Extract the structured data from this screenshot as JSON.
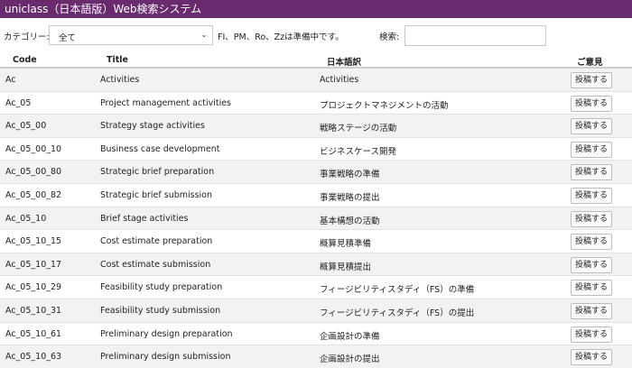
{
  "app": {
    "title": "uniclass（日本語版）Web検索システム"
  },
  "filters": {
    "category_label": "カテゴリー:",
    "category_value": "全て",
    "note": "FI、PM、Ro、Zzは準備中です。",
    "search_label": "検索:",
    "search_value": ""
  },
  "table": {
    "headers": {
      "code": "Code",
      "title": "Title",
      "japanese": "日本語訳",
      "feedback": "ご意見"
    },
    "button_label": "投稿する",
    "rows": [
      {
        "code": "Ac",
        "title": "Activities",
        "japanese": "Activities"
      },
      {
        "code": "Ac_05",
        "title": "Project management activities",
        "japanese": "プロジェクトマネジメントの活動"
      },
      {
        "code": "Ac_05_00",
        "title": "Strategy stage activities",
        "japanese": "戦略ステージの活動"
      },
      {
        "code": "Ac_05_00_10",
        "title": "Business case development",
        "japanese": "ビジネスケース開発"
      },
      {
        "code": "Ac_05_00_80",
        "title": "Strategic brief preparation",
        "japanese": "事業戦略の準備"
      },
      {
        "code": "Ac_05_00_82",
        "title": "Strategic brief submission",
        "japanese": "事業戦略の提出"
      },
      {
        "code": "Ac_05_10",
        "title": "Brief stage activities",
        "japanese": "基本構想の活動"
      },
      {
        "code": "Ac_05_10_15",
        "title": "Cost estimate preparation",
        "japanese": "概算見積準備"
      },
      {
        "code": "Ac_05_10_17",
        "title": "Cost estimate submission",
        "japanese": "概算見積提出"
      },
      {
        "code": "Ac_05_10_29",
        "title": "Feasibility study preparation",
        "japanese": "フィージビリティスタディ（FS）の準備"
      },
      {
        "code": "Ac_05_10_31",
        "title": "Feasibility study submission",
        "japanese": "フィージビリティスタディ（FS）の提出"
      },
      {
        "code": "Ac_05_10_61",
        "title": "Preliminary design preparation",
        "japanese": "企画設計の準備"
      },
      {
        "code": "Ac_05_10_63",
        "title": "Preliminary design submission",
        "japanese": "企画設計の提出"
      }
    ]
  }
}
